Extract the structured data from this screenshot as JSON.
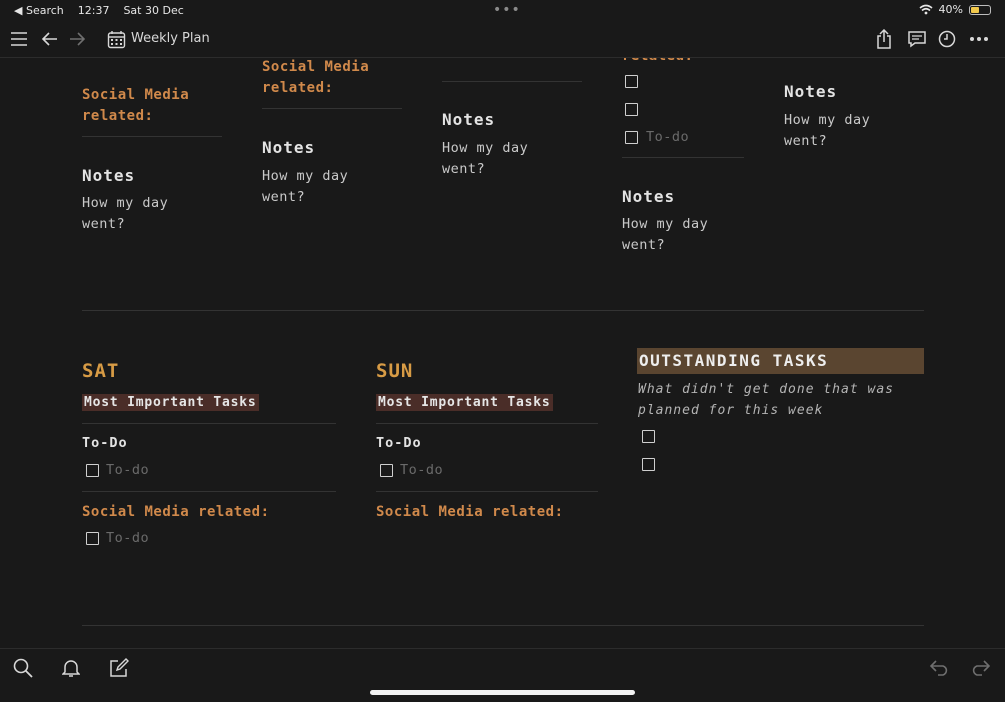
{
  "status": {
    "back_app": "◀ Search",
    "time": "12:37",
    "date": "Sat 30 Dec",
    "dots": "•••",
    "battery": "40%"
  },
  "toolbar": {
    "title": "Weekly Plan"
  },
  "top_columns": [
    {
      "social_heading_1": "Social Media",
      "social_heading_2": "related:",
      "notes_title": "Notes",
      "notes_1": "How my day",
      "notes_2": "went?"
    },
    {
      "social_heading_1": "Social Media",
      "social_heading_2": "related:",
      "notes_title": "Notes",
      "notes_1": "How my day",
      "notes_2": "went?"
    },
    {
      "notes_title": "Notes",
      "notes_1": "How my day",
      "notes_2": "went?"
    },
    {
      "partial_heading": "related:",
      "todo_placeholder": "To-do",
      "notes_title": "Notes",
      "notes_1": "How my day",
      "notes_2": "went?"
    },
    {
      "notes_title": "Notes",
      "notes_1": "How my day",
      "notes_2": "went?"
    }
  ],
  "sat": {
    "day": "SAT",
    "mit": "Most Important Tasks",
    "todo_heading": "To-Do",
    "todo_placeholder": "To-do",
    "social_heading": "Social Media related:",
    "social_placeholder": "To-do"
  },
  "sun": {
    "day": "SUN",
    "mit": "Most Important Tasks",
    "todo_heading": "To-Do",
    "todo_placeholder": "To-do",
    "social_heading": "Social Media related:"
  },
  "outstanding": {
    "title": "OUTSTANDING TASKS",
    "desc_1": "What didn't get done that was",
    "desc_2": "planned for this week"
  },
  "colors": {
    "accent_orange": "#d0894b",
    "day_gold": "#d79b45",
    "highlight_brown": "#4a2d28",
    "outstanding_bg": "#5a4530"
  }
}
